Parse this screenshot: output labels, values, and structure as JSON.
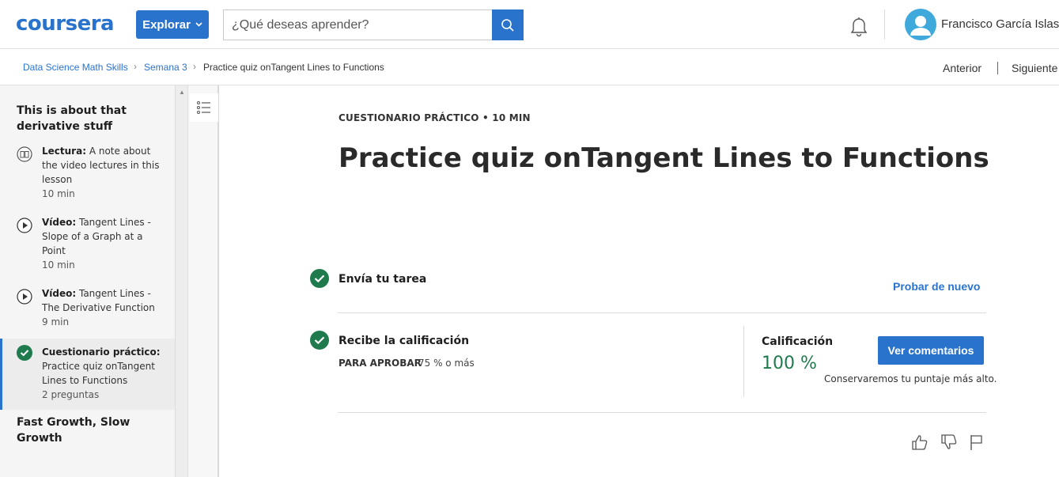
{
  "header": {
    "logo": "coursera",
    "explore_label": "Explorar",
    "search_placeholder": "¿Qué deseas aprender?",
    "user_name": "Francisco García Islas"
  },
  "breadcrumb": {
    "course": "Data Science Math Skills",
    "week": "Semana 3",
    "current": "Practice quiz onTangent Lines to Functions"
  },
  "nav": {
    "prev": "Anterior",
    "next": "Siguiente"
  },
  "sidebar": {
    "section_title": "This is about that derivative stuff",
    "items": [
      {
        "type": "Lectura:",
        "title": " A note about the video lectures in this lesson",
        "duration": "10 min",
        "icon": "book-icon"
      },
      {
        "type": "Vídeo:",
        "title": " Tangent Lines - Slope of a Graph at a Point",
        "duration": "10 min",
        "icon": "play-icon"
      },
      {
        "type": "Vídeo:",
        "title": " Tangent Lines - The Derivative Function",
        "duration": "9 min",
        "icon": "play-icon"
      },
      {
        "type": "Cuestionario práctico:",
        "title": " Practice quiz onTangent Lines to Functions",
        "duration": "2 preguntas",
        "icon": "check-icon"
      }
    ],
    "next_section_title": "Fast Growth, Slow Growth"
  },
  "main": {
    "kicker": "CUESTIONARIO PRÁCTICO • 10 MIN",
    "title": "Practice quiz onTangent Lines to Functions",
    "submit_step": "Envía tu tarea",
    "retry_label": "Probar de nuevo",
    "grade_step": "Recibe la calificación",
    "pass_label": "PARA APROBAR",
    "pass_value": "75 % o más",
    "grade_label": "Calificación",
    "grade_value": "100 %",
    "feedback_label": "Ver comentarios",
    "keep_note": "Conservaremos tu puntaje más alto."
  },
  "colors": {
    "brand": "#2a73cc",
    "success": "#1f7a4d"
  }
}
